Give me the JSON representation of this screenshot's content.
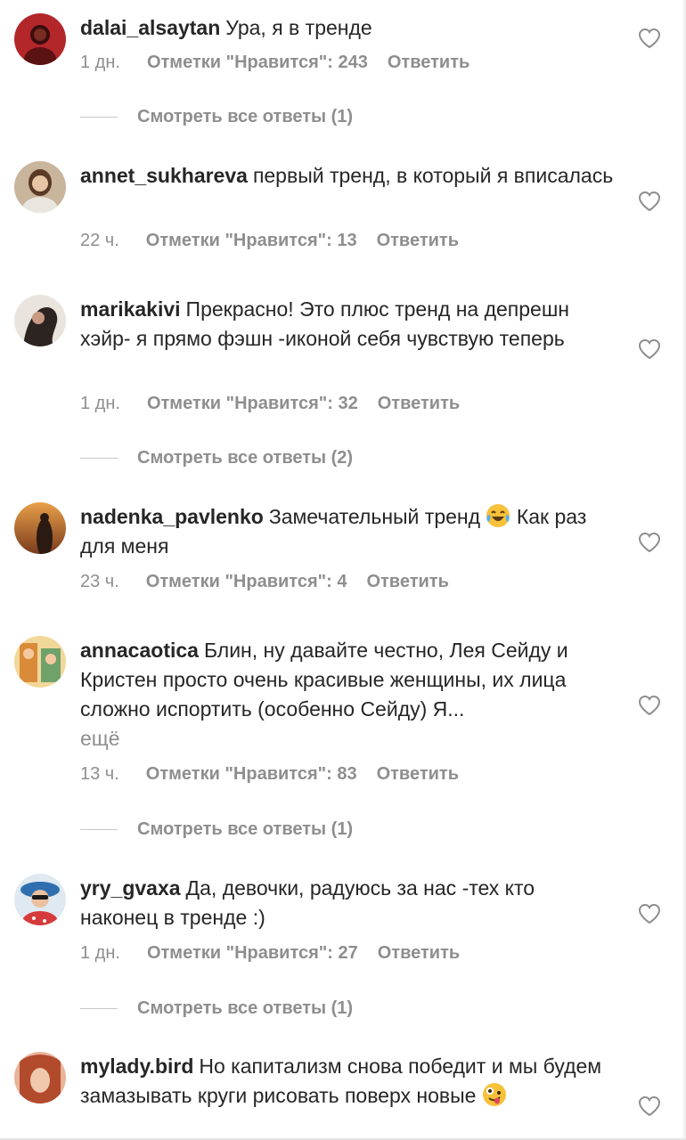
{
  "comments": [
    {
      "username": "dalai_alsaytan",
      "text": "Ура, я в тренде",
      "time": "1 дн.",
      "likes": "Отметки \"Нравится\": 243",
      "reply": "Ответить",
      "view_replies": "Смотреть все ответы (1)",
      "avatar_color": "#b3262a"
    },
    {
      "username": "annet_sukhareva",
      "text": "первый тренд, в который я вписалась",
      "time": "22 ч.",
      "likes": "Отметки \"Нравится\": 13",
      "reply": "Ответить",
      "avatar_color": "#c9b49c"
    },
    {
      "username": "marikakivi",
      "text": "Прекрасно! Это плюс тренд на депрешн хэйр- я прямо фэшн -иконой себя чувствую теперь",
      "time": "1 дн.",
      "likes": "Отметки \"Нравится\": 32",
      "reply": "Ответить",
      "view_replies": "Смотреть все ответы (2)",
      "avatar_color": "#3a2f2a"
    },
    {
      "username": "nadenka_pavlenko",
      "text": "Замечательный тренд",
      "emoji": "laughing-crying-emoji",
      "text_after": "Как раз для меня",
      "time": "23 ч.",
      "likes": "Отметки \"Нравится\": 4",
      "reply": "Ответить",
      "avatar_color": "#c9823e"
    },
    {
      "username": "annacaotica",
      "text": "Блин, ну давайте честно, Лея Сейду и Кристен просто очень красивые женщины, их лица сложно испортить (особенно Сейду) Я...",
      "more": "ещё",
      "time": "13 ч.",
      "likes": "Отметки \"Нравится\": 83",
      "reply": "Ответить",
      "view_replies": "Смотреть все ответы (1)",
      "avatar_color": "#e0b25a"
    },
    {
      "username": "yry_gvaxa",
      "text": "Да, девочки, радуюсь за нас -тех кто наконец в тренде :)",
      "time": "1 дн.",
      "likes": "Отметки \"Нравится\": 27",
      "reply": "Ответить",
      "view_replies": "Смотреть все ответы (1)",
      "avatar_color": "#2f6fb0"
    },
    {
      "username": "mylady.bird",
      "text": "Но капитализм снова победит и мы будем замазывать круги рисовать поверх новые",
      "emoji": "zany-face-emoji",
      "avatar_color": "#b24a2c"
    }
  ],
  "icons": {
    "heart": "heart-outline-icon"
  },
  "colors": {
    "text": "#262626",
    "secondary": "#8e8e8e"
  }
}
